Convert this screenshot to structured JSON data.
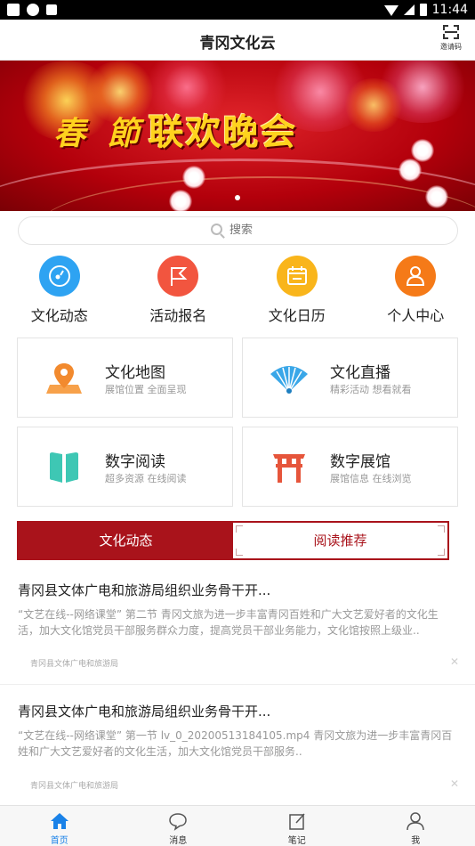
{
  "status_bar": {
    "time": "11:44"
  },
  "header": {
    "title": "青冈文化云",
    "scan_label": "邀请码"
  },
  "search": {
    "placeholder": "搜索"
  },
  "quick_nav": [
    {
      "label": "文化动态",
      "icon": "compass-icon",
      "color": "#2ea3f2"
    },
    {
      "label": "活动报名",
      "icon": "flag-icon",
      "color": "#f2553f"
    },
    {
      "label": "文化日历",
      "icon": "calendar-icon",
      "color": "#f9b51b"
    },
    {
      "label": "个人中心",
      "icon": "user-icon",
      "color": "#f57a18"
    }
  ],
  "features": [
    {
      "title": "文化地图",
      "subtitle": "展馆位置 全面呈现",
      "icon": "map-pin-icon"
    },
    {
      "title": "文化直播",
      "subtitle": "精彩活动 想看就看",
      "icon": "fan-icon"
    },
    {
      "title": "数字阅读",
      "subtitle": "超多资源 在线阅读",
      "icon": "book-icon"
    },
    {
      "title": "数字展馆",
      "subtitle": "展馆信息 在线浏览",
      "icon": "gate-icon"
    }
  ],
  "tabs": [
    {
      "label": "文化动态",
      "active": true
    },
    {
      "label": "阅读推荐",
      "active": false
    }
  ],
  "articles": [
    {
      "title": "青冈县文体广电和旅游局组织业务骨干开...",
      "summary": "“文艺在线--网络课堂” 第二节 青冈文旅为进一步丰富青冈百姓和广大文艺爱好者的文化生活，加大文化馆党员干部服务群众力度，提高党员干部业务能力，文化馆按照上级业..",
      "source": "青冈县文体广电和旅游局"
    },
    {
      "title": "青冈县文体广电和旅游局组织业务骨干开...",
      "summary": "“文艺在线--网络课堂” 第一节 lv_0_20200513184105.mp4 青冈文旅为进一步丰富青冈百姓和广大文艺爱好者的文化生活，加大文化馆党员干部服务..",
      "source": "青冈县文体广电和旅游局"
    }
  ],
  "bottom_nav": [
    {
      "label": "首页",
      "icon": "home-icon",
      "active": true
    },
    {
      "label": "消息",
      "icon": "message-icon",
      "active": false
    },
    {
      "label": "笔记",
      "icon": "note-icon",
      "active": false
    },
    {
      "label": "我",
      "icon": "profile-icon",
      "active": false
    }
  ],
  "colors": {
    "accent": "#a9131b",
    "nav_active": "#1a82e8"
  }
}
